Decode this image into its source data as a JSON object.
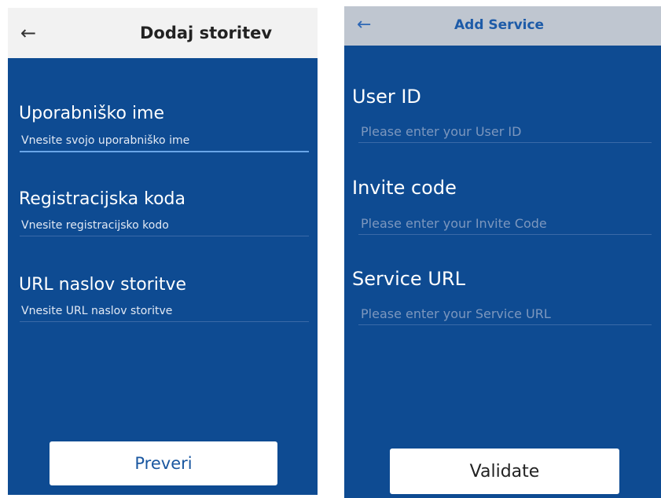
{
  "left_screen": {
    "title": "Dodaj storitev",
    "back_icon": "←",
    "fields": [
      {
        "label": "Uporabniško ime",
        "placeholder": "Vnesite svojo uporabniško ime",
        "value": ""
      },
      {
        "label": "Registracijska koda",
        "placeholder": "Vnesite registracijsko kodo",
        "value": ""
      },
      {
        "label": "URL naslov storitve",
        "placeholder": "Vnesite URL naslov storitve",
        "value": ""
      }
    ],
    "button_label": "Preveri"
  },
  "right_screen": {
    "title": "Add Service",
    "back_icon": "←",
    "fields": [
      {
        "label": "User ID",
        "placeholder": "Please enter your User ID",
        "value": ""
      },
      {
        "label": "Invite code",
        "placeholder": "Please enter your Invite Code",
        "value": ""
      },
      {
        "label": "Service URL",
        "placeholder": "Please enter your Service URL",
        "value": ""
      }
    ],
    "button_label": "Validate"
  },
  "colors": {
    "background_blue": "#0e4b92",
    "left_appbar": "#f2f2f2",
    "right_appbar": "#bfc6d0",
    "right_title": "#1d5ba8"
  }
}
